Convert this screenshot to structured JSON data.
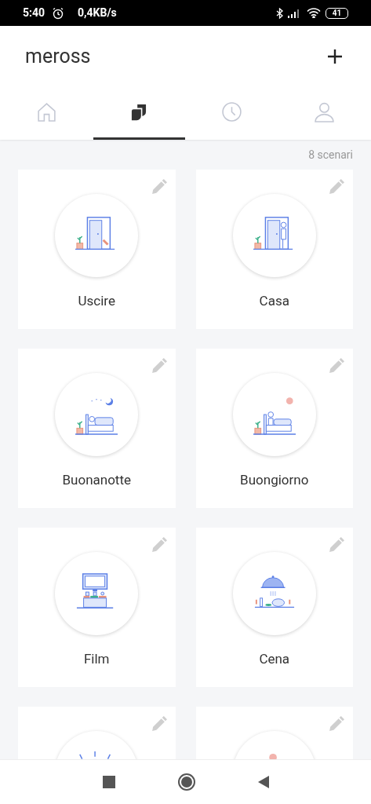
{
  "status_bar": {
    "time": "5:40",
    "speed": "0,4KB/s",
    "battery": "41"
  },
  "header": {
    "title": "meross"
  },
  "tabs": [
    {
      "kind": "home",
      "selected": false
    },
    {
      "kind": "scenes",
      "selected": true
    },
    {
      "kind": "clock",
      "selected": false
    },
    {
      "kind": "user",
      "selected": false
    }
  ],
  "scene_count": "8 scenari",
  "scenes": [
    {
      "label": "Uscire",
      "kind": "leave"
    },
    {
      "label": "Casa",
      "kind": "home"
    },
    {
      "label": "Buonanotte",
      "kind": "night"
    },
    {
      "label": "Buongiorno",
      "kind": "morning"
    },
    {
      "label": "Film",
      "kind": "movie"
    },
    {
      "label": "Cena",
      "kind": "dinner"
    },
    {
      "kind": "party"
    },
    {
      "kind": "sun"
    }
  ]
}
